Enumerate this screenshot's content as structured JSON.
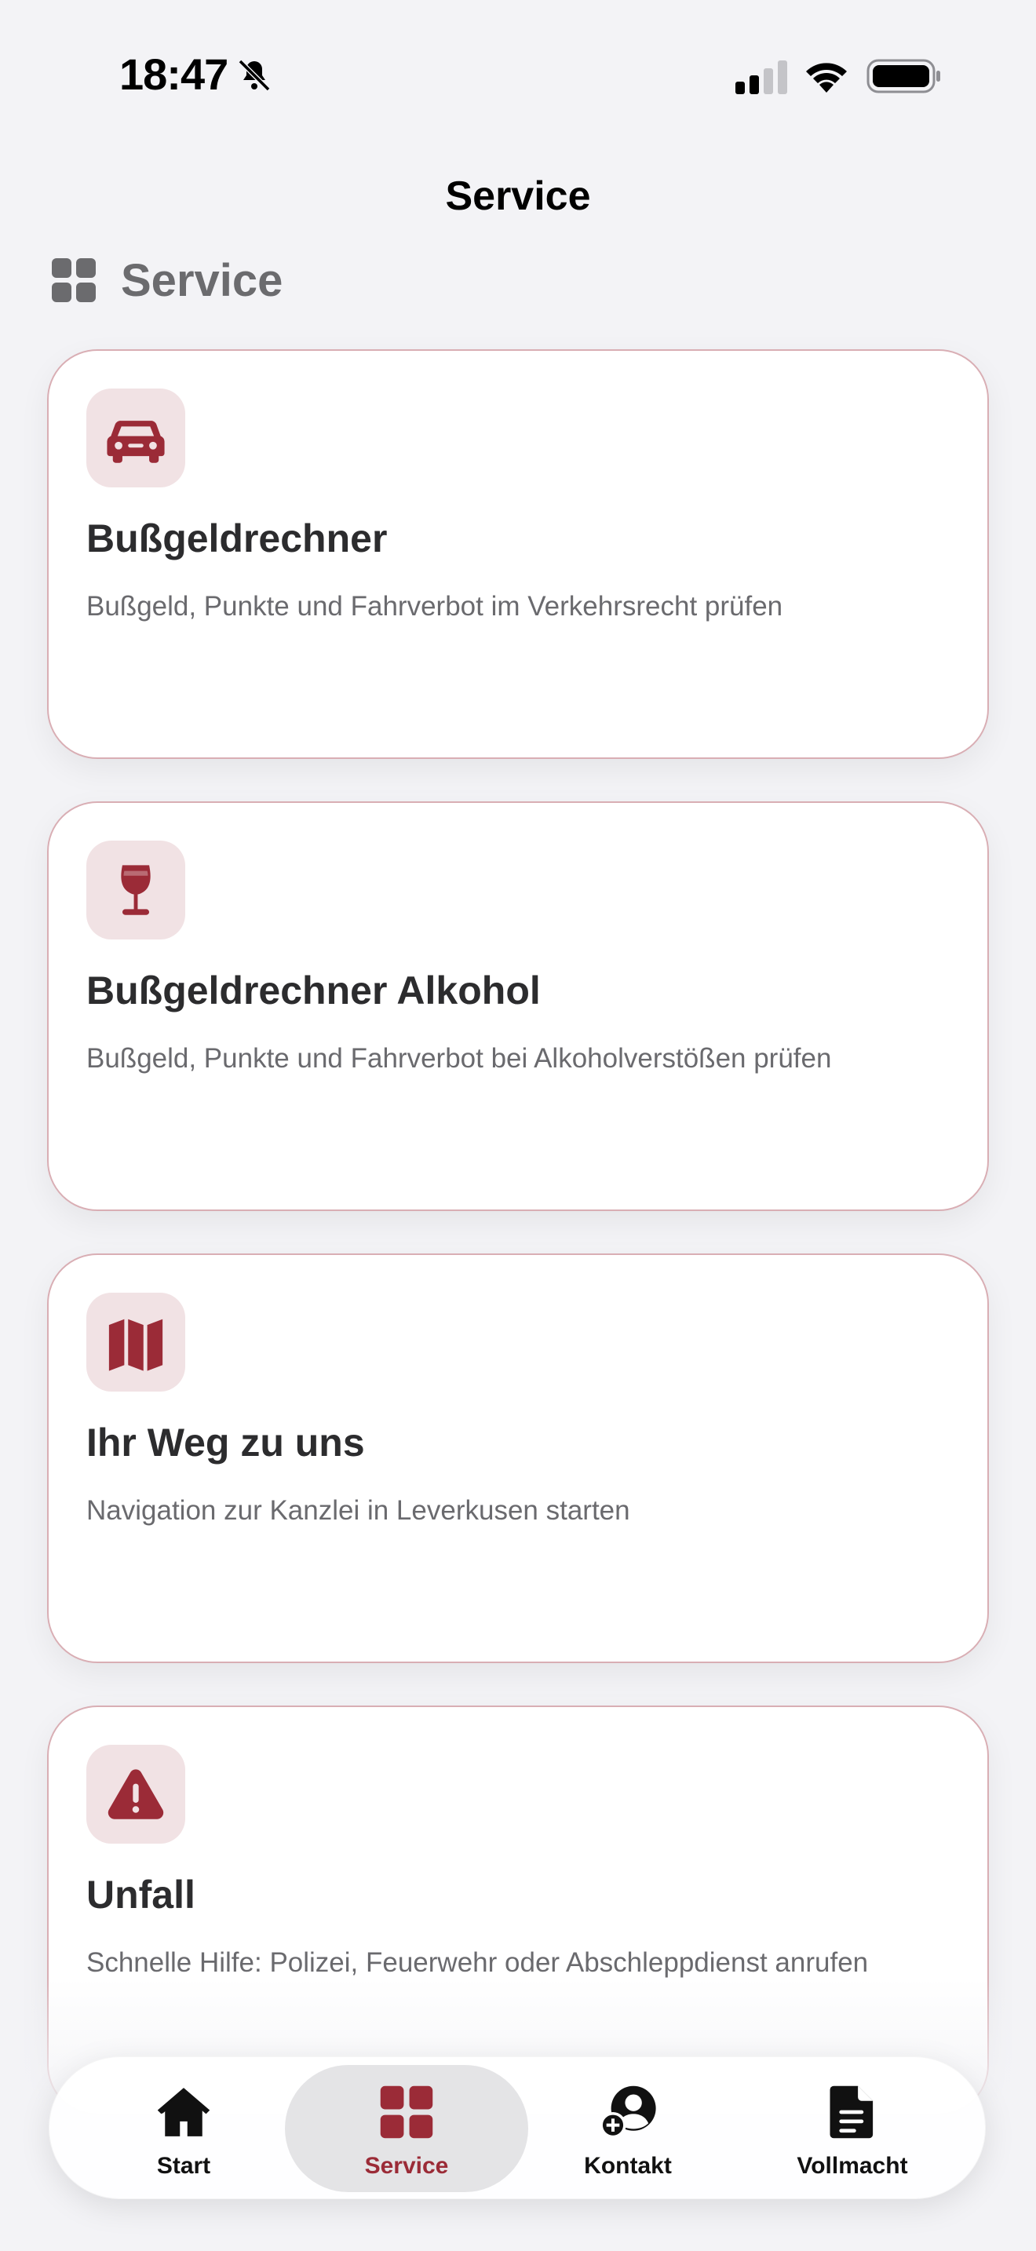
{
  "status_bar": {
    "time": "18:47"
  },
  "nav": {
    "title": "Service"
  },
  "section": {
    "title": "Service",
    "icon": "grid-icon"
  },
  "colors": {
    "accent": "#9b2b37",
    "icon_bg": "#f1e2e4",
    "card_border": "#d9aeb4",
    "background": "#f3f3f6"
  },
  "cards": [
    {
      "icon": "car-icon",
      "title": "Bußgeldrechner",
      "description": "Bußgeld, Punkte und Fahrverbot im Verkehrsrecht prüfen"
    },
    {
      "icon": "wine-glass-icon",
      "title": "Bußgeldrechner Alkohol",
      "description": "Bußgeld, Punkte und Fahrverbot bei Alkoholverstößen prüfen"
    },
    {
      "icon": "map-icon",
      "title": "Ihr Weg zu uns",
      "description": "Navigation zur Kanzlei in Leverkusen starten"
    },
    {
      "icon": "warning-icon",
      "title": "Unfall",
      "description": "Schnelle Hilfe: Polizei, Feuerwehr oder Abschleppdienst anrufen"
    }
  ],
  "tabs": [
    {
      "label": "Start",
      "icon": "home-icon",
      "active": false
    },
    {
      "label": "Service",
      "icon": "grid-icon",
      "active": true
    },
    {
      "label": "Kontakt",
      "icon": "add-contact-icon",
      "active": false
    },
    {
      "label": "Vollmacht",
      "icon": "document-icon",
      "active": false
    }
  ]
}
